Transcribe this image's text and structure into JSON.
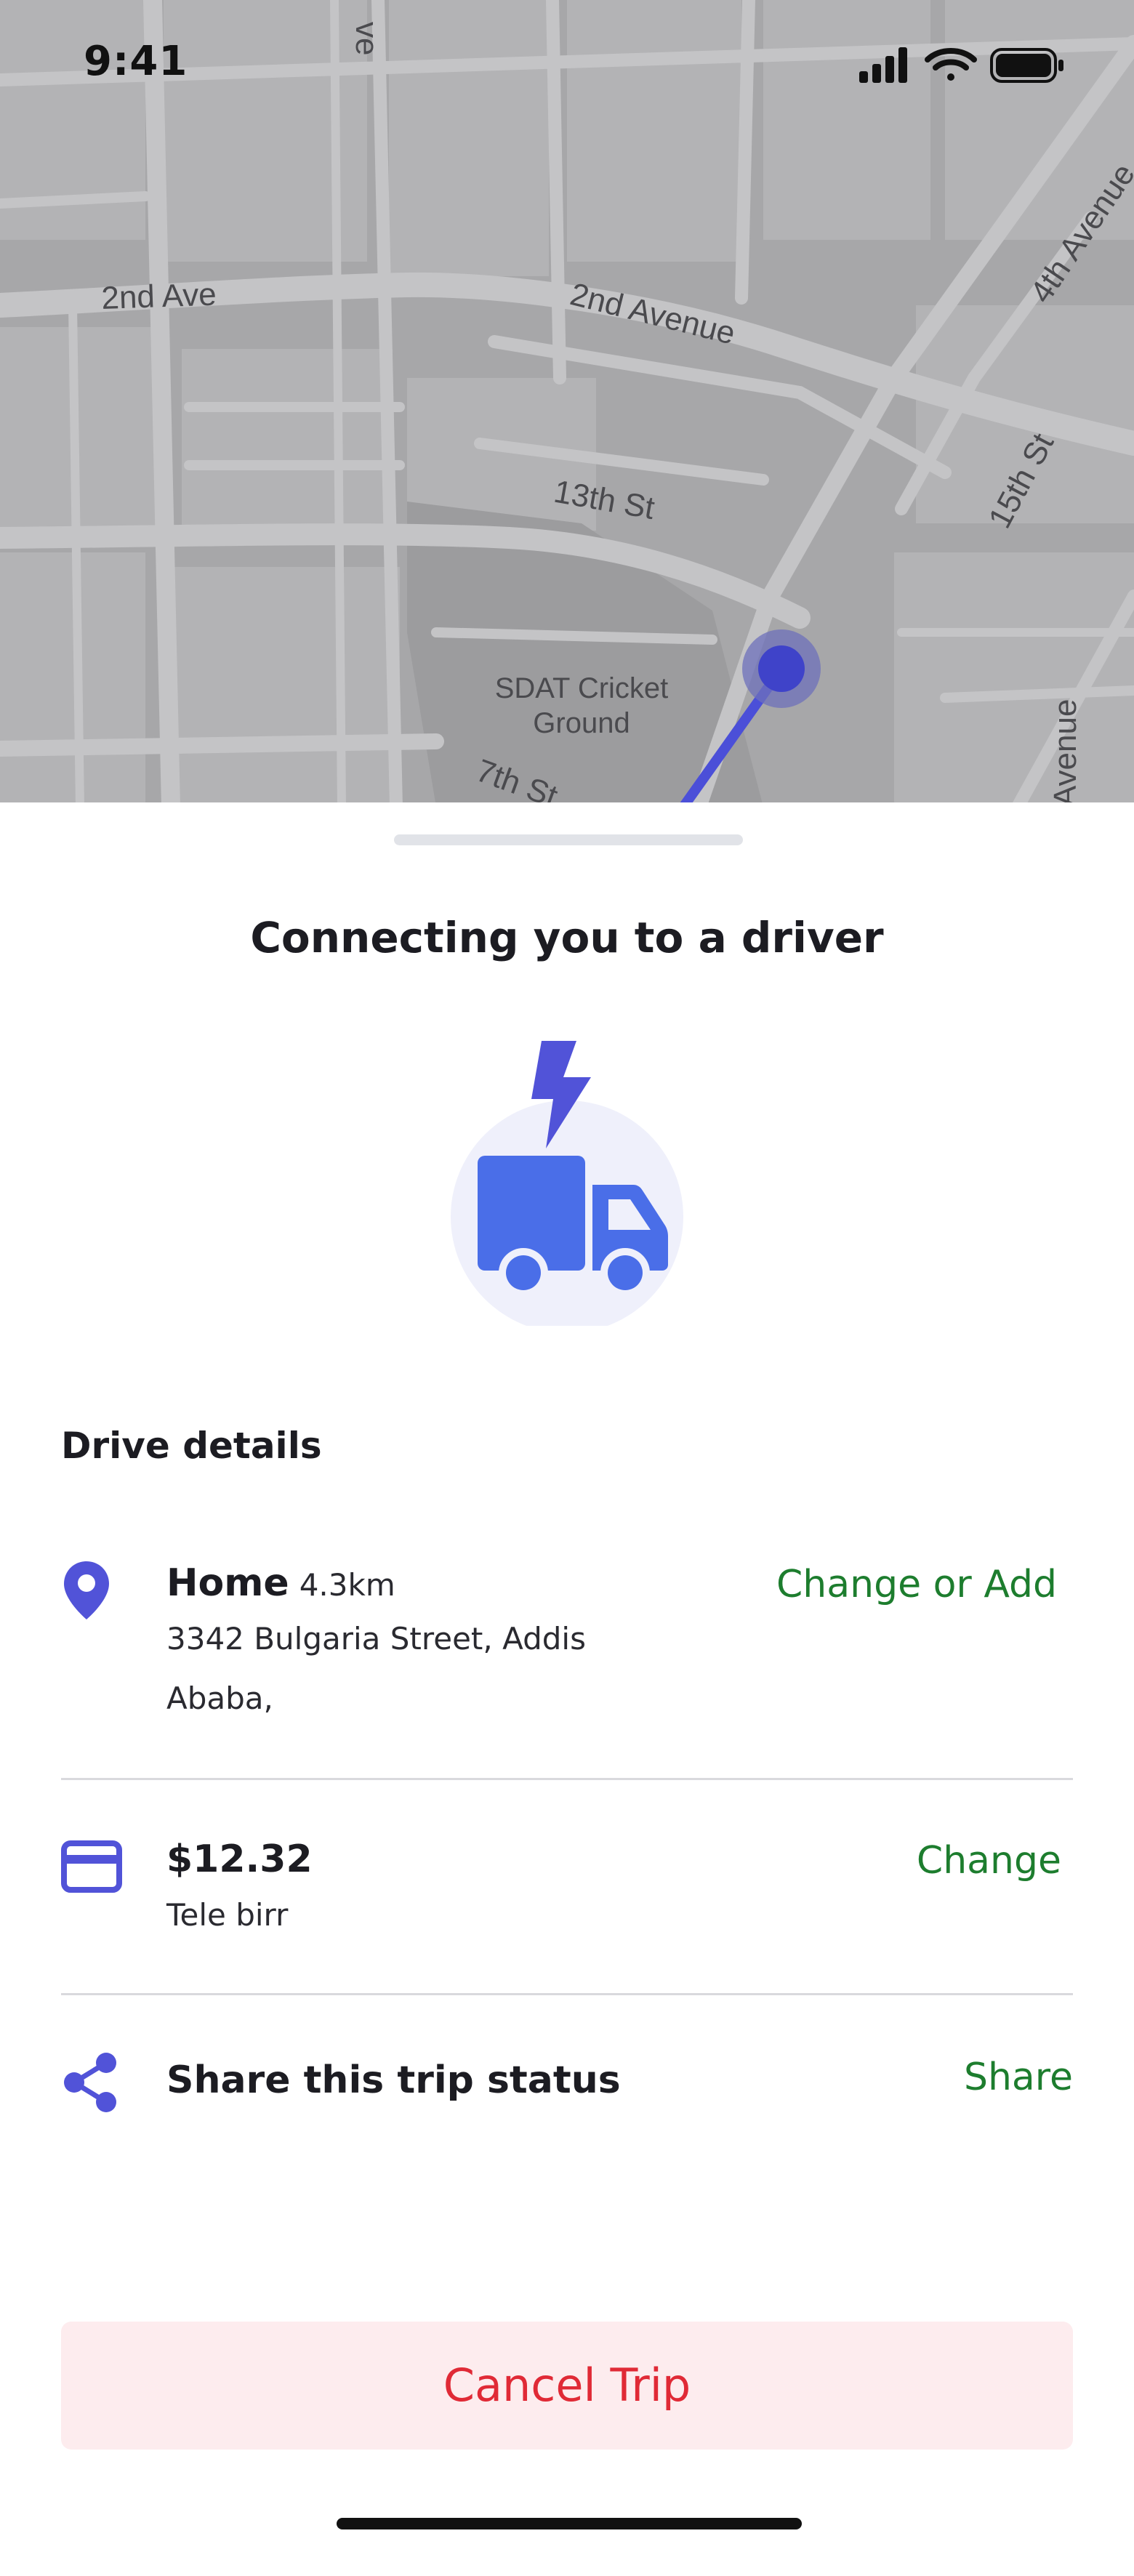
{
  "status_bar": {
    "time": "9:41",
    "icons": [
      "signal-icon",
      "wifi-icon",
      "battery-icon"
    ]
  },
  "map": {
    "labels": [
      "2nd Ave",
      "2nd Avenue",
      "13th St",
      "4th Avenue",
      "15th St",
      "SDAT Cricket",
      "Ground",
      "7th St",
      "ve",
      "Avenue"
    ],
    "route_color": "#4b4fd8",
    "pin_color": "#4b4fd8"
  },
  "sheet": {
    "title": "Connecting you to a driver",
    "illustration": "truck-icon",
    "accent_color": "#4a6ee8",
    "details_heading": "Drive details",
    "location": {
      "icon": "location-pin-icon",
      "title": "Home",
      "distance": "4.3km",
      "address_line1": "3342 Bulgaria Street, Addis",
      "address_line2": "Ababa,",
      "action": "Change or Add"
    },
    "payment": {
      "icon": "credit-card-icon",
      "amount": "$12.32",
      "method": "Tele birr",
      "action": "Change"
    },
    "share": {
      "icon": "share-icon",
      "title": "Share this trip status",
      "action": "Share"
    },
    "cancel_label": "Cancel Trip",
    "action_color": "#1d7d2e",
    "cancel_color": "#e02a36"
  }
}
